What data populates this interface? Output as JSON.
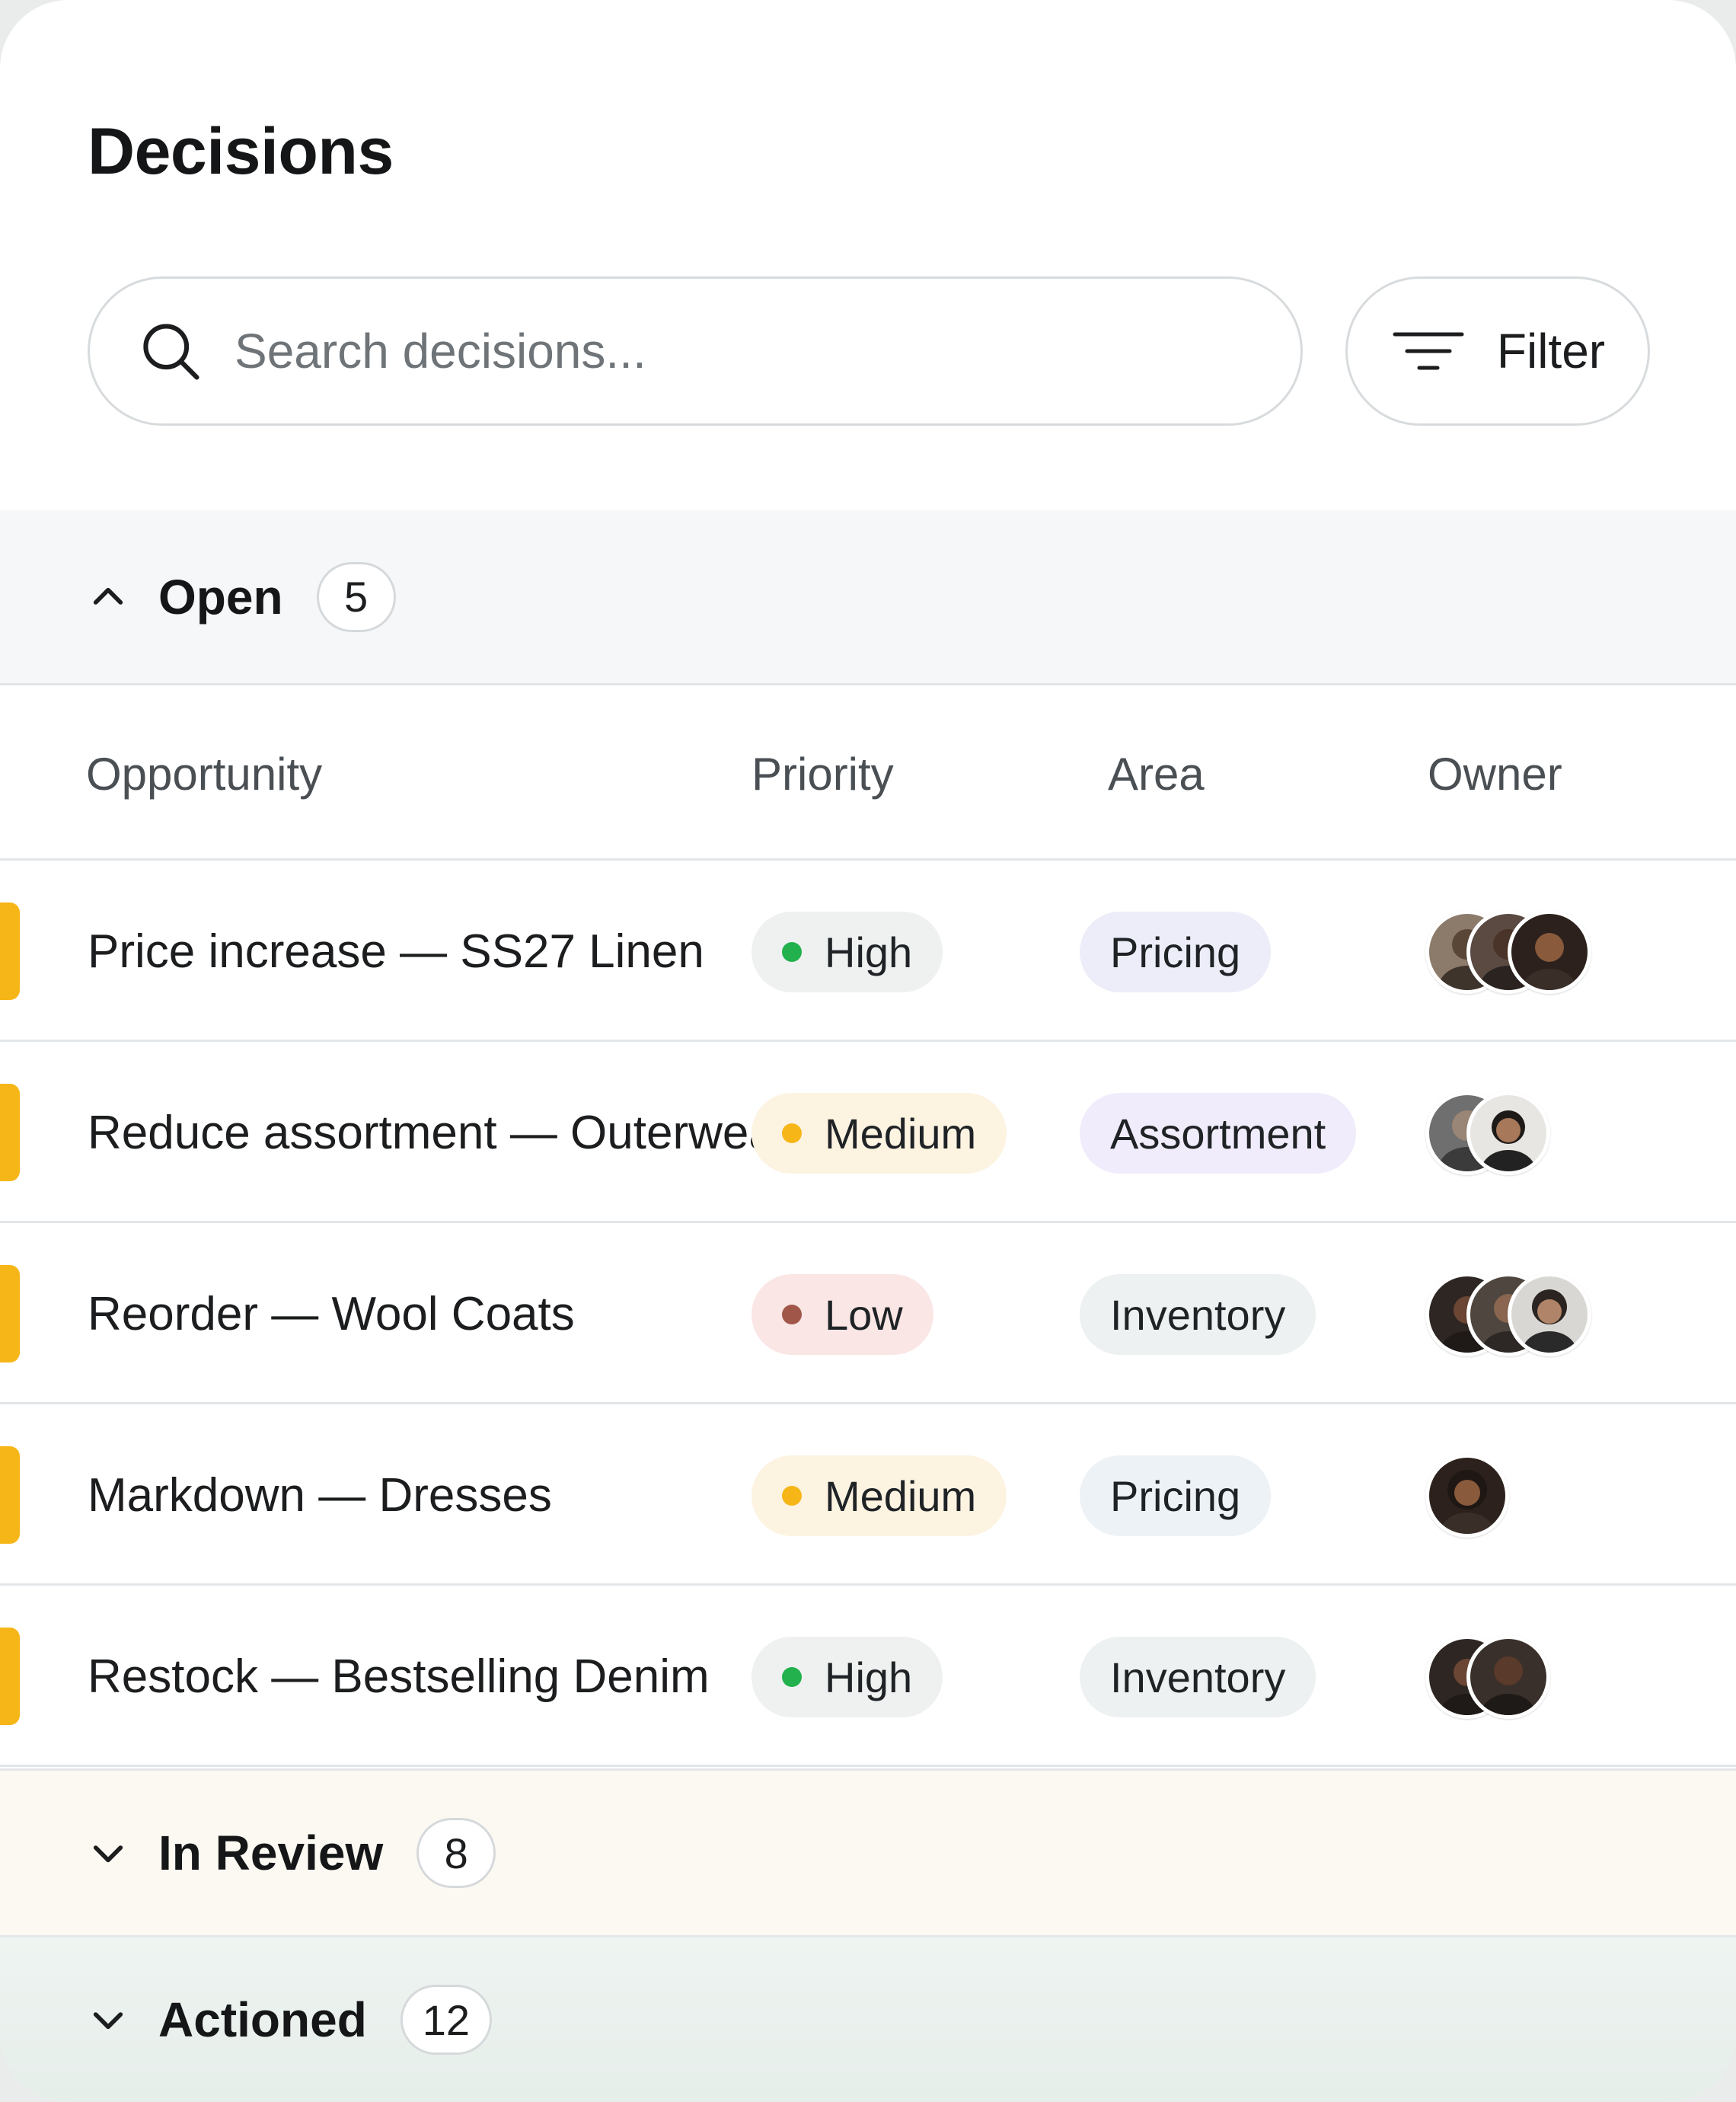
{
  "page": {
    "title": "Decisions"
  },
  "search": {
    "placeholder": "Search decisions..."
  },
  "filter": {
    "label": "Filter"
  },
  "sections": {
    "open": {
      "label": "Open",
      "count": "5",
      "expanded": true
    },
    "in_review": {
      "label": "In Review",
      "count": "8",
      "expanded": false
    },
    "actioned": {
      "label": "Actioned",
      "count": "12",
      "expanded": false
    }
  },
  "columns": {
    "opportunity": "Opportunity",
    "priority": "Priority",
    "area": "Area",
    "owner": "Owner"
  },
  "colors": {
    "accent": "#f7b617",
    "high_dot": "#22b14c",
    "medium_dot": "#f7b617",
    "low_dot": "#a0574a"
  },
  "rows": [
    {
      "opportunity": "Price increase — SS27 Linen",
      "priority": "High",
      "area": "Pricing",
      "owners": [
        "avatar-man-beard",
        "avatar-man-dark",
        "avatar-woman-curly"
      ]
    },
    {
      "opportunity": "Reduce assortment — Outerwear",
      "priority": "Medium",
      "area": "Assortment",
      "owners": [
        "avatar-man-gray",
        "avatar-man-longhair"
      ]
    },
    {
      "opportunity": "Reorder — Wool Coats",
      "priority": "Low",
      "area": "Inventory",
      "owners": [
        "avatar-woman-dark",
        "avatar-man-older",
        "avatar-woman-glasses"
      ]
    },
    {
      "opportunity": "Markdown — Dresses",
      "priority": "Medium",
      "area": "Pricing",
      "owners": [
        "avatar-woman-curly"
      ]
    },
    {
      "opportunity": "Restock — Bestselling Denim",
      "priority": "High",
      "area": "Inventory",
      "owners": [
        "avatar-woman-dark",
        "avatar-man-bald"
      ]
    }
  ]
}
